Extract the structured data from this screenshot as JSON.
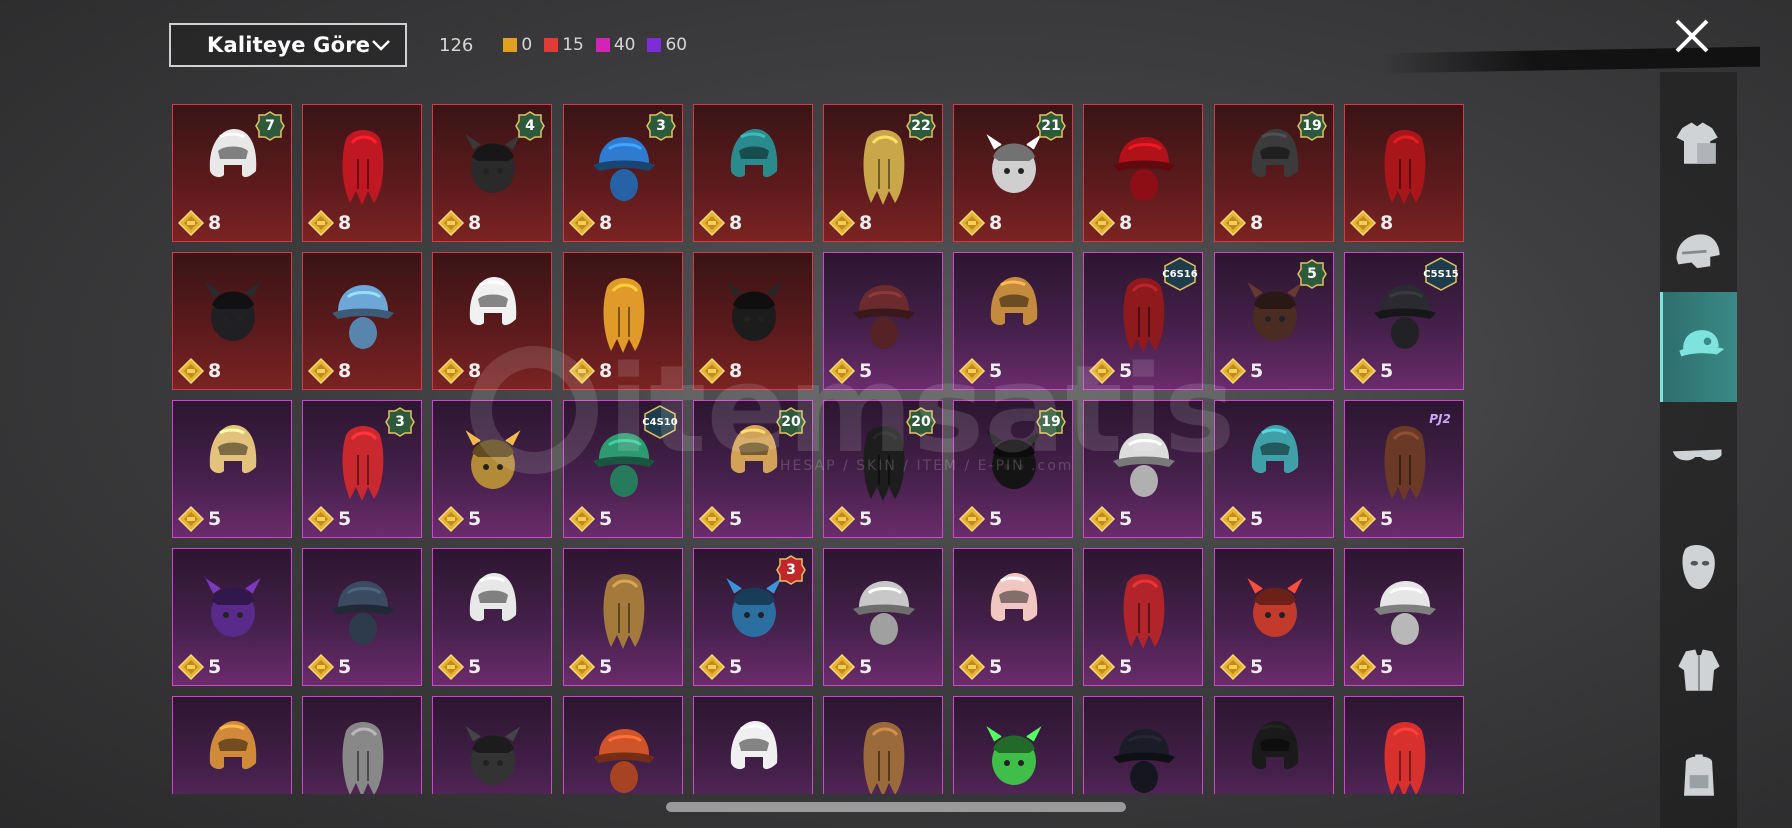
{
  "header": {
    "sort_label": "Kaliteye Göre",
    "total": "126",
    "counts": [
      {
        "value": "0",
        "color": "#e3a020"
      },
      {
        "value": "15",
        "color": "#e23a36"
      },
      {
        "value": "40",
        "color": "#d424b8"
      },
      {
        "value": "60",
        "color": "#7c2cd8"
      }
    ]
  },
  "watermark": {
    "logo": "itemsatis",
    "sub": "HESAP / SKIN / ITEM / E-PIN .com"
  },
  "sidebar": {
    "tabs": [
      {
        "name": "outfit",
        "icon": "outfit-icon"
      },
      {
        "name": "helmet",
        "icon": "helmet-icon"
      },
      {
        "name": "hat",
        "icon": "cap-icon",
        "active": true
      },
      {
        "name": "glasses",
        "icon": "glasses-icon"
      },
      {
        "name": "face",
        "icon": "mask-icon"
      },
      {
        "name": "jacket",
        "icon": "jacket-icon"
      },
      {
        "name": "backpack",
        "icon": "backpack-icon"
      }
    ]
  },
  "items": [
    {
      "rarity": "red",
      "price": "8",
      "badge": "7",
      "badge_type": "level",
      "icon": "white-wig-icon",
      "color": "#e8e8e8"
    },
    {
      "rarity": "red",
      "price": "8",
      "badge": "",
      "badge_type": "",
      "icon": "red-helmet-icon",
      "color": "#c01822"
    },
    {
      "rarity": "red",
      "price": "8",
      "badge": "4",
      "badge_type": "level",
      "icon": "snowman-hat-icon",
      "color": "#2a2a2a"
    },
    {
      "rarity": "red",
      "price": "8",
      "badge": "3",
      "badge_type": "level",
      "icon": "joker-head-icon",
      "color": "#2f7bd0"
    },
    {
      "rarity": "red",
      "price": "8",
      "badge": "",
      "badge_type": "",
      "icon": "teal-helm-icon",
      "color": "#2b8b8c"
    },
    {
      "rarity": "red",
      "price": "8",
      "badge": "22",
      "badge_type": "level",
      "icon": "gold-helm-icon",
      "color": "#c9a64a"
    },
    {
      "rarity": "red",
      "price": "8",
      "badge": "21",
      "badge_type": "level",
      "icon": "oni-mask-icon",
      "color": "#cfcfcf"
    },
    {
      "rarity": "red",
      "price": "8",
      "badge": "",
      "badge_type": "",
      "icon": "demon-mask-icon",
      "color": "#b1121a"
    },
    {
      "rarity": "red",
      "price": "8",
      "badge": "19",
      "badge_type": "level",
      "icon": "dark-helmet-icon",
      "color": "#3b3b3b"
    },
    {
      "rarity": "red",
      "price": "8",
      "badge": "",
      "badge_type": "",
      "icon": "red-mask-helmet-icon",
      "color": "#a8161a"
    },
    {
      "rarity": "red",
      "price": "8",
      "badge": "",
      "badge_type": "",
      "icon": "bat-helmet-icon",
      "color": "#1f1f24"
    },
    {
      "rarity": "red",
      "price": "8",
      "badge": "",
      "badge_type": "",
      "icon": "crystal-helm-icon",
      "color": "#6ea6d8"
    },
    {
      "rarity": "red",
      "price": "8",
      "badge": "",
      "badge_type": "",
      "icon": "racing-helmet-icon",
      "color": "#f1f1f1"
    },
    {
      "rarity": "red",
      "price": "8",
      "badge": "",
      "badge_type": "",
      "icon": "robot-head-icon",
      "color": "#e09a2a"
    },
    {
      "rarity": "red",
      "price": "8",
      "badge": "",
      "badge_type": "",
      "icon": "pirate-hat-icon",
      "color": "#1c1c1c"
    },
    {
      "rarity": "purple",
      "price": "5",
      "badge": "",
      "badge_type": "",
      "icon": "auburn-hair-icon",
      "color": "#6a2a2e"
    },
    {
      "rarity": "purple",
      "price": "5",
      "badge": "",
      "badge_type": "",
      "icon": "blonde-hair-icon",
      "color": "#c48a3e"
    },
    {
      "rarity": "purple",
      "price": "5",
      "badge": "C6S16",
      "badge_type": "season",
      "icon": "red-hair-icon",
      "color": "#8e1a1e"
    },
    {
      "rarity": "purple",
      "price": "5",
      "badge": "5",
      "badge_type": "level",
      "icon": "bunny-hair-icon",
      "color": "#4a2c22"
    },
    {
      "rarity": "purple",
      "price": "5",
      "badge": "C5S15",
      "badge_type": "season",
      "icon": "black-cap-icon",
      "color": "#2a2a30"
    },
    {
      "rarity": "purple",
      "price": "5",
      "badge": "",
      "badge_type": "",
      "icon": "officer-cap-icon",
      "color": "#e2c27c"
    },
    {
      "rarity": "purple",
      "price": "5",
      "badge": "3",
      "badge_type": "level",
      "icon": "jester-hat-icon",
      "color": "#c9282e"
    },
    {
      "rarity": "purple",
      "price": "5",
      "badge": "",
      "badge_type": "",
      "icon": "gold-horn-helm-icon",
      "color": "#b38a38"
    },
    {
      "rarity": "purple",
      "price": "5",
      "badge": "C4S10",
      "badge_type": "season",
      "icon": "green-helmet-icon",
      "color": "#2e9a72"
    },
    {
      "rarity": "purple",
      "price": "5",
      "badge": "20",
      "badge_type": "level",
      "icon": "blonde-horn-icon",
      "color": "#d2a356"
    },
    {
      "rarity": "purple",
      "price": "5",
      "badge": "20",
      "badge_type": "level",
      "icon": "black-gold-helm-icon",
      "color": "#1d1d1d"
    },
    {
      "rarity": "purple",
      "price": "5",
      "badge": "19",
      "badge_type": "level",
      "icon": "black-bun-hair-icon",
      "color": "#141414"
    },
    {
      "rarity": "purple",
      "price": "5",
      "badge": "",
      "badge_type": "",
      "icon": "crown-wig-icon",
      "color": "#dcdcdc"
    },
    {
      "rarity": "purple",
      "price": "5",
      "badge": "",
      "badge_type": "",
      "icon": "cyber-head-icon",
      "color": "#3fa0a8"
    },
    {
      "rarity": "purple",
      "price": "5",
      "badge": "PJ2",
      "badge_type": "text",
      "icon": "gas-mask-icon",
      "color": "#6b3a26"
    },
    {
      "rarity": "purple",
      "price": "5",
      "badge": "",
      "badge_type": "",
      "icon": "mecha-head-icon",
      "color": "#5a2a8a"
    },
    {
      "rarity": "purple",
      "price": "5",
      "badge": "",
      "badge_type": "",
      "icon": "hood-mask-icon",
      "color": "#3a4a60"
    },
    {
      "rarity": "purple",
      "price": "5",
      "badge": "",
      "badge_type": "",
      "icon": "rooster-head-icon",
      "color": "#e8e8e8"
    },
    {
      "rarity": "purple",
      "price": "5",
      "badge": "",
      "badge_type": "",
      "icon": "chef-pot-icon",
      "color": "#a37a3c"
    },
    {
      "rarity": "purple",
      "price": "5",
      "badge": "3",
      "badge_type": "level-red",
      "icon": "tassel-hat-icon",
      "color": "#2b6ea0"
    },
    {
      "rarity": "purple",
      "price": "5",
      "badge": "",
      "badge_type": "",
      "icon": "silver-hair-icon",
      "color": "#c8c8c8"
    },
    {
      "rarity": "purple",
      "price": "5",
      "badge": "",
      "badge_type": "",
      "icon": "baby-head-icon",
      "color": "#f2c7c2"
    },
    {
      "rarity": "purple",
      "price": "5",
      "badge": "",
      "badge_type": "",
      "icon": "guard-hat-icon",
      "color": "#b1242a"
    },
    {
      "rarity": "purple",
      "price": "5",
      "badge": "",
      "badge_type": "",
      "icon": "feather-mask-icon",
      "color": "#c23a2c"
    },
    {
      "rarity": "purple",
      "price": "5",
      "badge": "",
      "badge_type": "",
      "icon": "lion-head-icon",
      "color": "#e6e6e6"
    },
    {
      "rarity": "purple",
      "price": "",
      "badge": "",
      "badge_type": "",
      "icon": "camel-head-icon",
      "color": "#d08a3a"
    },
    {
      "rarity": "purple",
      "price": "",
      "badge": "",
      "badge_type": "",
      "icon": "bow-hat-icon",
      "color": "#888888"
    },
    {
      "rarity": "purple",
      "price": "",
      "badge": "",
      "badge_type": "",
      "icon": "fedora-icon",
      "color": "#333333"
    },
    {
      "rarity": "purple",
      "price": "",
      "badge": "",
      "badge_type": "",
      "icon": "bandana-icon",
      "color": "#d0542a"
    },
    {
      "rarity": "purple",
      "price": "",
      "badge": "",
      "badge_type": "",
      "icon": "zebra-head-icon",
      "color": "#f0f0f0"
    },
    {
      "rarity": "purple",
      "price": "",
      "badge": "",
      "badge_type": "",
      "icon": "antelope-head-icon",
      "color": "#9a6a3a"
    },
    {
      "rarity": "purple",
      "price": "",
      "badge": "",
      "badge_type": "",
      "icon": "frog-pilot-icon",
      "color": "#3fbf4a"
    },
    {
      "rarity": "purple",
      "price": "",
      "badge": "",
      "badge_type": "",
      "icon": "neon-helmet-icon",
      "color": "#1c1c28"
    },
    {
      "rarity": "purple",
      "price": "",
      "badge": "",
      "badge_type": "",
      "icon": "beanie-icon",
      "color": "#1a1a1a"
    },
    {
      "rarity": "purple",
      "price": "",
      "badge": "",
      "badge_type": "",
      "icon": "crab-hat-icon",
      "color": "#d8302c"
    }
  ]
}
